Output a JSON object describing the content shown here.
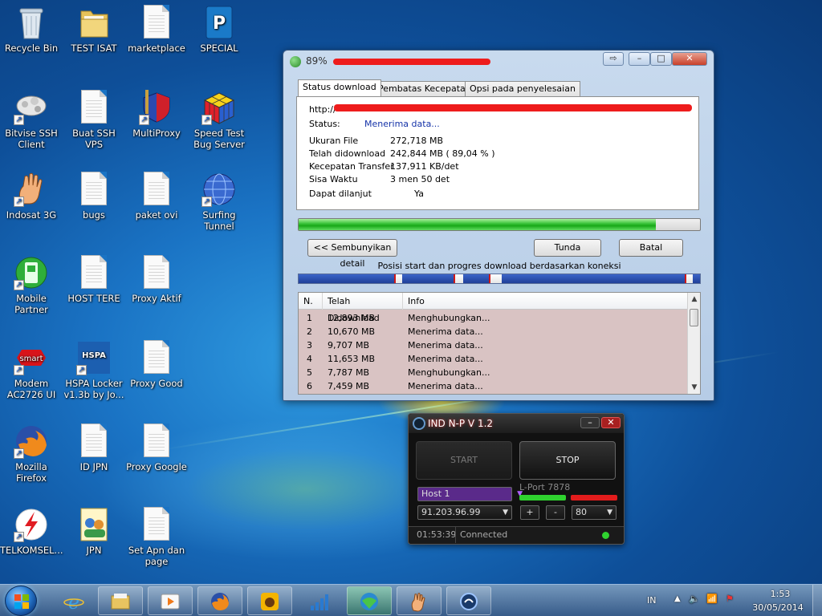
{
  "desktop": {
    "icons": [
      {
        "label": "Recycle Bin",
        "icon": "recycle-bin-icon"
      },
      {
        "label": "TEST ISAT",
        "icon": "folder-icon"
      },
      {
        "label": "marketplace",
        "icon": "document-icon"
      },
      {
        "label": "SPECIAL",
        "icon": "publisher-icon"
      },
      {
        "label": "Bitvise SSH Client",
        "icon": "bitvise-icon"
      },
      {
        "label": "Buat SSH VPS",
        "icon": "document-icon"
      },
      {
        "label": "MultiProxy",
        "icon": "multiproxy-icon"
      },
      {
        "label": "Speed Test Bug Server",
        "icon": "rubik-cube-icon"
      },
      {
        "label": "Indosat 3G",
        "icon": "hand-icon"
      },
      {
        "label": "bugs",
        "icon": "document-icon"
      },
      {
        "label": "paket ovi",
        "icon": "document-icon"
      },
      {
        "label": "Surfing Tunnel",
        "icon": "globe-icon"
      },
      {
        "label": "Mobile Partner",
        "icon": "mobile-partner-icon"
      },
      {
        "label": "HOST TERE",
        "icon": "document-icon"
      },
      {
        "label": "Proxy Aktif",
        "icon": "document-icon"
      },
      {
        "label": "Modem AC2726 UI",
        "icon": "smart-icon"
      },
      {
        "label": "HSPA Locker v1.3b by Jo...",
        "icon": "hspa-icon"
      },
      {
        "label": "Proxy Good",
        "icon": "document-icon"
      },
      {
        "label": "Mozilla Firefox",
        "icon": "firefox-icon"
      },
      {
        "label": "ID JPN",
        "icon": "document-icon"
      },
      {
        "label": "Proxy Google",
        "icon": "document-icon"
      },
      {
        "label": "TELKOMSEL...",
        "icon": "telkomsel-icon"
      },
      {
        "label": "JPN",
        "icon": "contacts-icon"
      },
      {
        "label": "Set Apn dan page",
        "icon": "document-icon"
      }
    ]
  },
  "idm": {
    "title": "89%",
    "tabs": [
      "Status download",
      "Pembatas Kecepatan",
      "Opsi pada penyelesaian"
    ],
    "url_label": "http://",
    "status_label": "Status:",
    "status_value": "Menerima data...",
    "fields": [
      {
        "label": "Ukuran File",
        "value": "272,718  MB"
      },
      {
        "label": "Telah didownload",
        "value": "242,844  MB  ( 89,04 % )"
      },
      {
        "label": "Kecepatan Transfer",
        "value": "137,911  KB/det"
      },
      {
        "label": "Sisa Waktu",
        "value": "3 men 50 det"
      },
      {
        "label": "Dapat dilanjut",
        "value": "Ya"
      }
    ],
    "progress": 0.8904,
    "buttons": {
      "hide": "<< Sembunyikan detail",
      "pause": "Tunda",
      "cancel": "Batal"
    },
    "connections_caption": "Posisi start dan progres download berdasarkan koneksi",
    "columns": [
      "N.",
      "Telah Didownload",
      "Info"
    ],
    "rows": [
      {
        "n": "1",
        "size": "12,893  MB",
        "info": "Menghubungkan..."
      },
      {
        "n": "2",
        "size": "10,670  MB",
        "info": "Menerima data..."
      },
      {
        "n": "3",
        "size": "9,707  MB",
        "info": "Menerima data..."
      },
      {
        "n": "4",
        "size": "11,653  MB",
        "info": "Menerima data..."
      },
      {
        "n": "5",
        "size": "7,787  MB",
        "info": "Menghubungkan..."
      },
      {
        "n": "6",
        "size": "7,459  MB",
        "info": "Menerima data..."
      }
    ]
  },
  "inp": {
    "title": "IND N-P V 1.2",
    "start": "START",
    "stop": "STOP",
    "host": "Host 1",
    "lport": "L-Port 7878",
    "ip": "91.203.96.99",
    "plus": "+",
    "minus": "-",
    "port": "80",
    "time": "01:53:39",
    "status": "Connected",
    "colors": {
      "green": "#2fd22f",
      "red": "#e21c1c",
      "host_bg": "#5a2a8a"
    }
  },
  "taskbar": {
    "items": [
      "start-orb",
      "internet-explorer",
      "windows-explorer",
      "media-player",
      "firefox",
      "gom-player",
      "signal-app",
      "internet-download-manager",
      "indosat-3g",
      "ind-np"
    ],
    "lang": "IN",
    "time": "1:53",
    "date": "30/05/2014"
  }
}
